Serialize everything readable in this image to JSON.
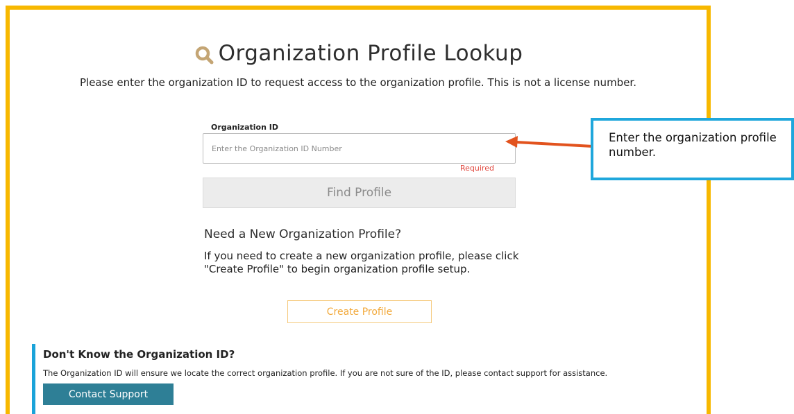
{
  "header": {
    "title": "Organization Profile Lookup",
    "icon": "search-icon",
    "icon_color": "#c4a574"
  },
  "intro_text": "Please enter the organization ID to request access to the organization profile. This is not a license number.",
  "org_id_field": {
    "label": "Organization ID",
    "placeholder": "Enter the Organization ID Number",
    "value": "",
    "validation": "Required"
  },
  "find_button": {
    "label": "Find Profile"
  },
  "new_profile": {
    "heading": "Need a New Organization Profile?",
    "description": "If you need to create a new organization profile, please click \"Create Profile\" to begin organization profile setup.",
    "button_label": "Create Profile"
  },
  "support": {
    "heading": "Don't Know the Organization ID?",
    "description": "The Organization ID will ensure we locate the correct organization profile. If you are not sure of the ID, please contact support for assistance.",
    "button_label": "Contact Support"
  },
  "callout": {
    "text": "Enter the organization profile number."
  },
  "colors": {
    "frame": "#f7b800",
    "support_accent": "#1aa3d9",
    "contact_button": "#2e7f96",
    "create_button_text": "#f2a93b",
    "required_text": "#e0443a",
    "callout_border": "#1fa7dc",
    "arrow": "#e2531e"
  }
}
